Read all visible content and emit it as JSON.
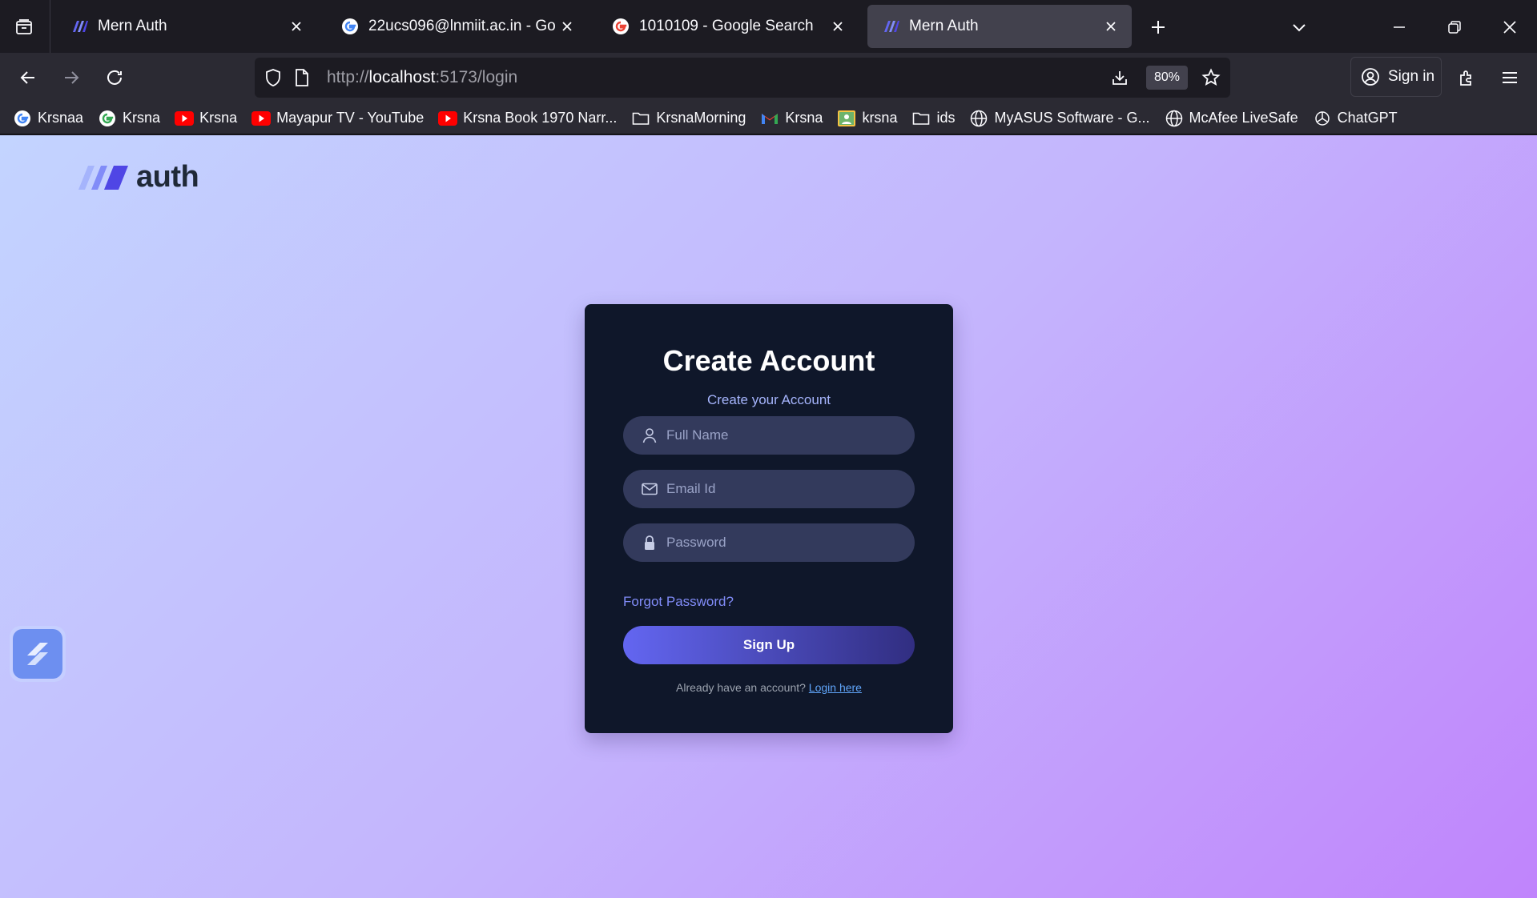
{
  "browser": {
    "tabs": [
      {
        "title": "Mern Auth",
        "favicon": "mern-auth-logo-icon",
        "active": false
      },
      {
        "title": "22ucs096@lnmiit.ac.in - Google",
        "favicon": "google-icon",
        "active": false
      },
      {
        "title": "1010109 - Google Search",
        "favicon": "google-icon",
        "active": false
      },
      {
        "title": "Mern Auth",
        "favicon": "mern-auth-logo-icon",
        "active": true
      }
    ],
    "url": {
      "scheme": "http://",
      "host": "localhost",
      "path": ":5173/login"
    },
    "zoom": "80%",
    "signin_label": "Sign in",
    "bookmarks": [
      {
        "label": "Krsnaa",
        "icon": "google-icon"
      },
      {
        "label": "Krsna",
        "icon": "google-icon"
      },
      {
        "label": "Krsna",
        "icon": "youtube-icon"
      },
      {
        "label": "Mayapur TV - YouTube",
        "icon": "youtube-icon"
      },
      {
        "label": "Krsna Book 1970 Narr...",
        "icon": "youtube-icon"
      },
      {
        "label": "KrsnaMorning",
        "icon": "folder-icon"
      },
      {
        "label": "Krsna",
        "icon": "gmail-icon"
      },
      {
        "label": "krsna",
        "icon": "contacts-icon"
      },
      {
        "label": "ids",
        "icon": "folder-icon"
      },
      {
        "label": "MyASUS Software - G...",
        "icon": "globe-icon"
      },
      {
        "label": "McAfee LiveSafe",
        "icon": "globe-icon"
      },
      {
        "label": "ChatGPT",
        "icon": "chatgpt-icon"
      }
    ]
  },
  "page": {
    "logo_text": "auth",
    "card": {
      "title": "Create Account",
      "subtitle": "Create your Account",
      "fields": {
        "full_name_placeholder": "Full Name",
        "email_placeholder": "Email Id",
        "password_placeholder": "Password"
      },
      "forgot_label": "Forgot Password?",
      "submit_label": "Sign Up",
      "login_prompt": "Already have an account?",
      "login_link": "Login here"
    }
  },
  "colors": {
    "card_bg": "#0f172a",
    "accent": "#6366f1",
    "link": "#818cf8"
  }
}
